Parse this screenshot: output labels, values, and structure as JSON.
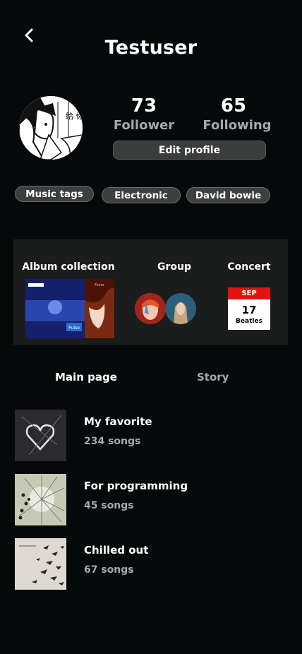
{
  "header": {
    "title": "Testuser",
    "back_icon": "chevron-left-icon"
  },
  "profile": {
    "followers": {
      "count": "73",
      "label": "Follower"
    },
    "following": {
      "count": "65",
      "label": "Following"
    },
    "edit_label": "Edit profile",
    "avatar_text": "給 你"
  },
  "tags": [
    "Music tags",
    "Electronic",
    "David bowie"
  ],
  "panel": {
    "album_label": "Album collection",
    "group_label": "Group",
    "concert_label": "Concert",
    "concert": {
      "month": "SEP",
      "day": "17",
      "name": "Beatles"
    },
    "album1_text": "Pulse",
    "album2_text": "Fever"
  },
  "tabs": {
    "main": "Main page",
    "story": "Story"
  },
  "playlists": [
    {
      "title": "My favorite",
      "count": "234 songs"
    },
    {
      "title": "For programming",
      "count": "45 songs"
    },
    {
      "title": "Chilled out",
      "count": "67 songs"
    }
  ],
  "colors": {
    "background": "#060909",
    "panel": "#1b1d1d",
    "muted_text": "#a7aaaa",
    "calendar_red": "#e81010"
  }
}
